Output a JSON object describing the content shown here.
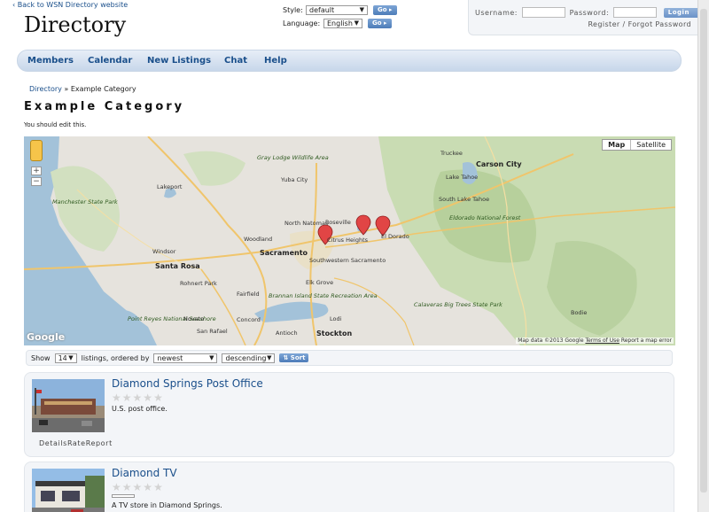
{
  "header": {
    "back_link": "‹ Back to WSN Directory website",
    "site_title": "Directory",
    "style_label": "Style:",
    "style_value": "default",
    "language_label": "Language:",
    "language_value": "English",
    "go_label": "Go ▸"
  },
  "login": {
    "username_label": "Username:",
    "password_label": "Password:",
    "login_button": "Login ▸",
    "register": "Register",
    "separator": "/",
    "forgot": "Forgot Password"
  },
  "nav": {
    "items": [
      {
        "label": "Members"
      },
      {
        "label": "Calendar"
      },
      {
        "label": "New Listings"
      },
      {
        "label": "Chat"
      },
      {
        "label": "Help"
      }
    ]
  },
  "breadcrumb": {
    "root": "Directory",
    "separator": "»",
    "current": "Example Category"
  },
  "page": {
    "title": "Example Category",
    "edit_note": "You should edit this."
  },
  "map": {
    "type_map": "Map",
    "type_satellite": "Satellite",
    "logo": "Google",
    "attribution": "Map data ©2013 Google",
    "terms": "Terms of Use",
    "report": "Report a map error",
    "zoom_in": "+",
    "zoom_out": "−",
    "labels": {
      "gray_lodge": "Gray Lodge Wildlife Area",
      "yuba_city": "Yuba City",
      "truckee": "Truckee",
      "carson_city": "Carson City",
      "manchester": "Manchester State Park",
      "lakeport": "Lakeport",
      "south_lake": "South Lake Tahoe",
      "lake_tahoe": "Lake Tahoe",
      "eldorado": "Eldorado National Forest",
      "north_natomas": "North Natomas",
      "roseville": "Roseville",
      "citrus": "Citrus Heights",
      "el_dorado": "El Dorado",
      "woodland": "Woodland",
      "sacramento": "Sacramento",
      "southwestern": "Southwestern Sacramento",
      "santa_rosa": "Santa Rosa",
      "rohnert": "Rohnert Park",
      "fairfield": "Fairfield",
      "elk_grove": "Elk Grove",
      "brannan": "Brannan Island State Recreation Area",
      "calaveras": "Calaveras Big Trees State Park",
      "point_reyes": "Point Reyes National Seashore",
      "novato": "Novato",
      "san_rafael": "San Rafael",
      "concord": "Concord",
      "antioch": "Antioch",
      "lodi": "Lodi",
      "stockton": "Stockton",
      "bodie": "Bodie",
      "windsor": "Windsor"
    }
  },
  "sort": {
    "show_label": "Show",
    "count": "14",
    "ordered_label": "listings, ordered by",
    "order_field": "newest",
    "direction": "descending",
    "sort_button": "⇅ Sort"
  },
  "listings": [
    {
      "title": "Diamond Springs Post Office",
      "description": "U.S. post office.",
      "actions": [
        "Details",
        "Rate",
        "Report"
      ]
    },
    {
      "title": "Diamond TV",
      "description": "A TV store in Diamond Springs."
    }
  ],
  "star_glyph": "★"
}
